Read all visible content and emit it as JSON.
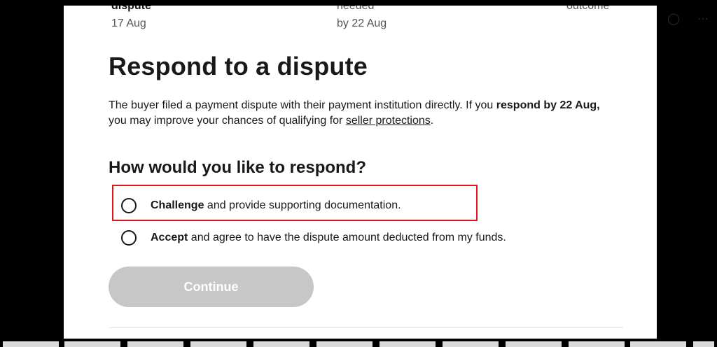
{
  "timeline": [
    {
      "label": "dispute",
      "date": "17 Aug"
    },
    {
      "label": "needed",
      "date": "by 22 Aug"
    },
    {
      "label": "outcome",
      "date": ""
    }
  ],
  "title": "Respond to a dispute",
  "description": {
    "part1": "The buyer filed a payment dispute with their payment institution directly. If you ",
    "bold1": "respond by 22 Aug,",
    "part2": " you may improve your chances of qualifying for ",
    "link": "seller protections",
    "part3": "."
  },
  "question": "How would you like to respond?",
  "options": [
    {
      "bold": "Challenge",
      "rest": " and provide supporting documentation."
    },
    {
      "bold": "Accept",
      "rest": " and agree to have the dispute amount deducted from my funds."
    }
  ],
  "continue_label": "Continue",
  "top_icons": [
    "settings-icon",
    "more-icon"
  ],
  "colors": {
    "highlight": "#e0141e",
    "button_disabled": "#c7c7c7",
    "text": "#191919"
  }
}
